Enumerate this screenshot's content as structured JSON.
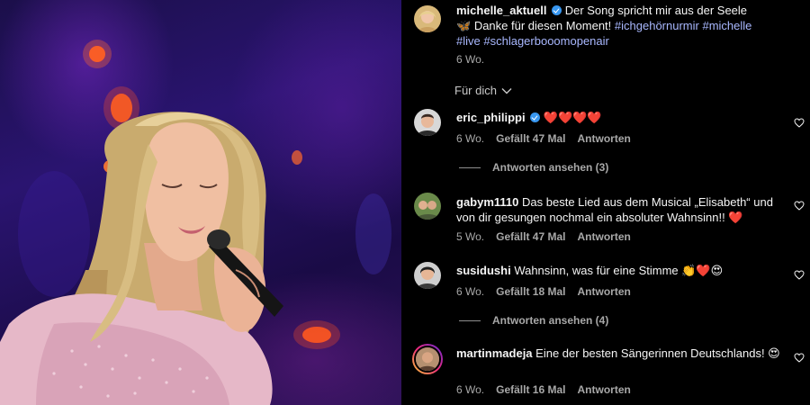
{
  "post": {
    "username": "michelle_aktuell",
    "caption_prefix": "Der Song spricht mir aus der Seele",
    "butterfly_emoji": "🦋",
    "caption_suffix": "Danke für diesen Moment!",
    "hashtags": [
      "#ichgehörnurmir",
      "#michelle",
      "#live",
      "#schlagerbooomopenair"
    ],
    "time": "6 Wo.",
    "verified": true
  },
  "sort": {
    "label": "Für dich",
    "icon": "chevron-down-icon"
  },
  "comments": [
    {
      "username": "eric_philippi",
      "verified": true,
      "text": "❤️❤️❤️❤️",
      "time": "6 Wo.",
      "likes": "Gefällt 47 Mal",
      "reply": "Antworten",
      "view_replies": "Antworten ansehen (3)"
    },
    {
      "username": "gabym1110",
      "verified": false,
      "text": "Das beste Lied aus dem Musical „Elisabeth“ und von dir gesungen nochmal ein absoluter Wahnsinn!! ❤️",
      "time": "5 Wo.",
      "likes": "Gefällt 47 Mal",
      "reply": "Antworten",
      "view_replies": ""
    },
    {
      "username": "susidushi",
      "verified": false,
      "text": "Wahnsinn, was für eine Stimme 👏❤️😍",
      "time": "6 Wo.",
      "likes": "Gefällt 18 Mal",
      "reply": "Antworten",
      "view_replies": "Antworten ansehen (4)"
    },
    {
      "username": "martinmadeja",
      "verified": false,
      "text": "Eine der besten Sängerinnen Deutschlands! 😍",
      "time": "6 Wo.",
      "likes": "Gefällt 16 Mal",
      "reply": "Antworten",
      "view_replies": ""
    }
  ],
  "colors": {
    "background": "#000000",
    "text": "#f5f5f5",
    "secondary": "#a8a8a8",
    "hashtag": "#a9b8ff",
    "verified": "#3897f0"
  }
}
